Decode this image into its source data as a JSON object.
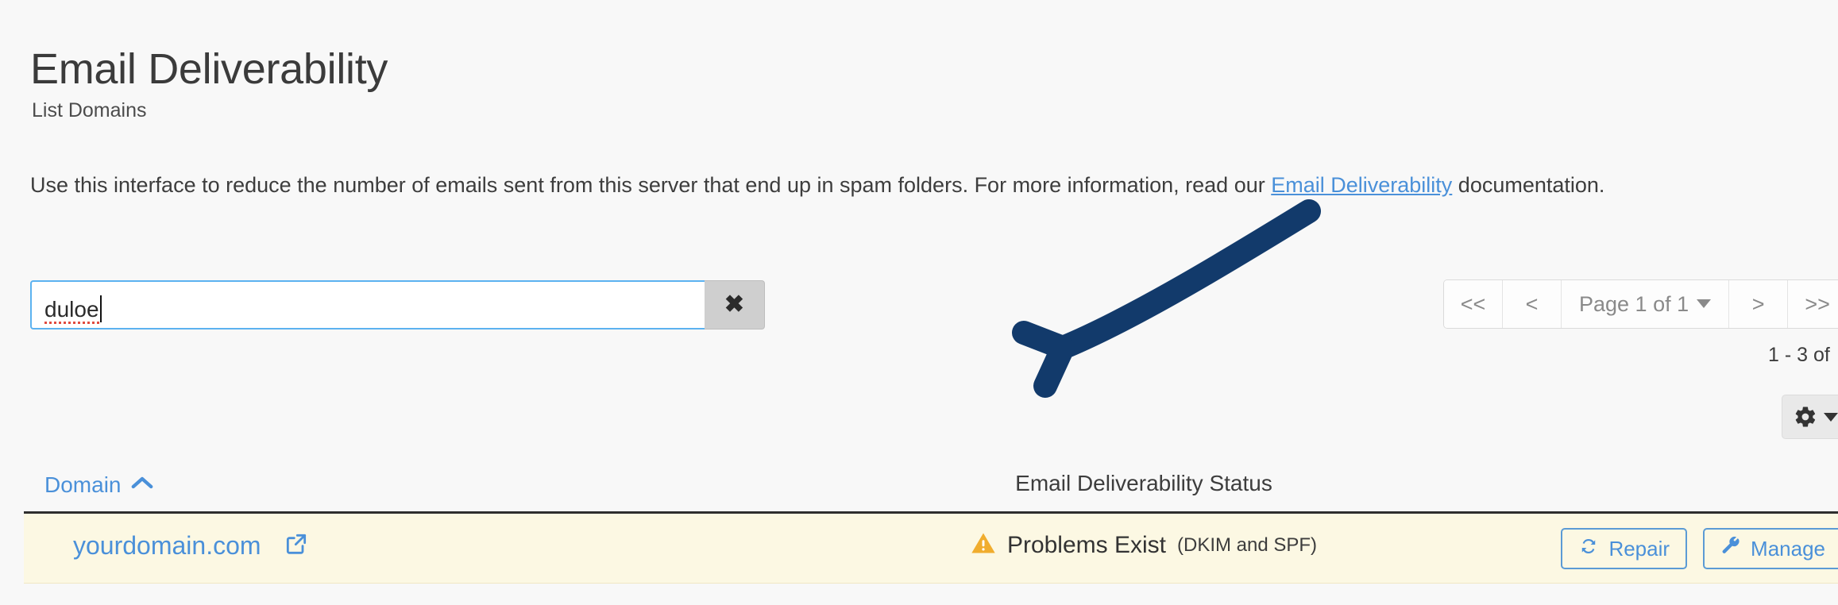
{
  "header": {
    "title": "Email Deliverability",
    "breadcrumb": "List Domains",
    "intro_before": "Use this interface to reduce the number of emails sent from this server that end up in spam folders. For more information, read our ",
    "intro_link": "Email Deliverability",
    "intro_after": " documentation."
  },
  "search": {
    "value": "duloe",
    "placeholder": "",
    "clear_label": "✖"
  },
  "pagination": {
    "first_label": "<<",
    "prev_label": "<",
    "page_label": "Page 1 of 1",
    "next_label": ">",
    "last_label": ">>",
    "range_label": "1 - 3 of"
  },
  "table": {
    "columns": {
      "domain": "Domain",
      "status": "Email Deliverability Status"
    },
    "sort": {
      "column": "Domain",
      "direction": "asc"
    },
    "rows": [
      {
        "domain": "yourdomain.com",
        "status_main": "Problems Exist",
        "status_detail": "(DKIM and SPF)",
        "status_kind": "warning",
        "repair_label": "Repair",
        "manage_label": "Manage"
      }
    ]
  },
  "colors": {
    "link": "#4a90d9",
    "warning_row_bg": "#fcf8e3",
    "warning_icon": "#f0ad2e",
    "annotation": "#123a6b",
    "focus_border": "#5cb2f0"
  }
}
